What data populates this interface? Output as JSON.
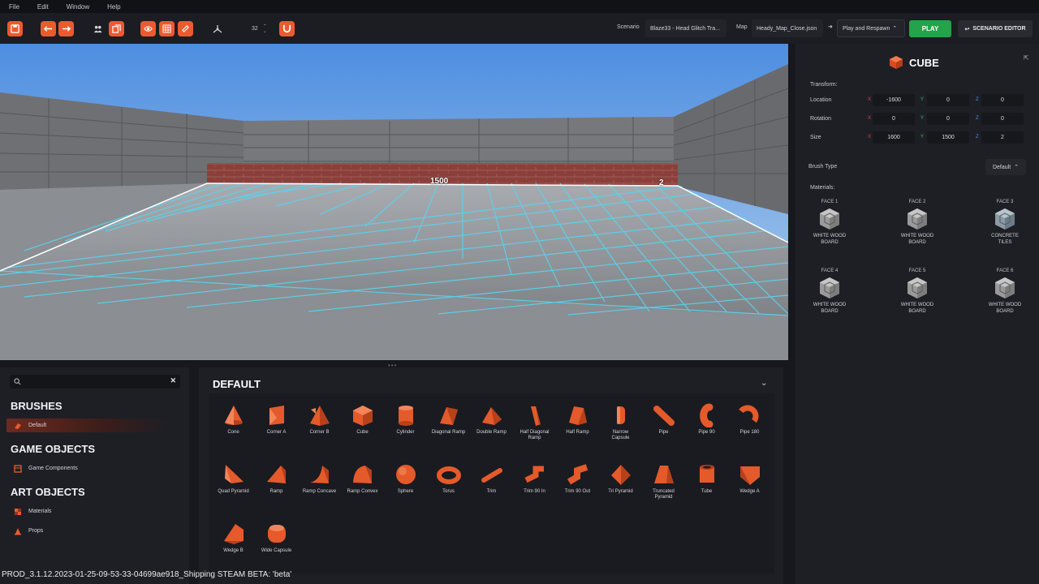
{
  "menu": [
    "File",
    "Edit",
    "Window",
    "Help"
  ],
  "toolbar": {
    "grid_size": "32",
    "scenario_label": "Scenario",
    "scenario_value": "Blaze33 - Head Glitch Tra...",
    "map_label": "Map",
    "map_value": "Heady_Map_Close.json",
    "respawn_label": "Play and Respawn",
    "play_label": "PLAY",
    "scenario_editor_label": "SCENARIO EDITOR",
    "accent": "#ec5a2f",
    "play_color": "#24a34a"
  },
  "viewport": {
    "dim_label_1": "1500",
    "dim_label_2": "2"
  },
  "inspector": {
    "title": "CUBE",
    "transform_label": "Transform:",
    "location_label": "Location",
    "rotation_label": "Rotation",
    "size_label": "Size",
    "axis_x": "X",
    "axis_y": "Y",
    "axis_z": "Z",
    "location": [
      "-1600",
      "0",
      "0"
    ],
    "rotation": [
      "0",
      "0",
      "0"
    ],
    "size": [
      "1600",
      "1500",
      "2"
    ],
    "brush_type_label": "Brush Type",
    "brush_type_value": "Default",
    "materials_label": "Materials:",
    "faces": [
      {
        "label": "FACE 1",
        "name_line1": "WHITE WOOD",
        "name_line2": "BOARD"
      },
      {
        "label": "FACE 2",
        "name_line1": "WHITE WOOD",
        "name_line2": "BOARD"
      },
      {
        "label": "FACE 3",
        "name_line1": "CONCRETE",
        "name_line2": "TILES"
      },
      {
        "label": "FACE 4",
        "name_line1": "WHITE WOOD",
        "name_line2": "BOARD"
      },
      {
        "label": "FACE 5",
        "name_line1": "WHITE WOOD",
        "name_line2": "BOARD"
      },
      {
        "label": "FACE 6",
        "name_line1": "WHITE WOOD",
        "name_line2": "BOARD"
      }
    ]
  },
  "library": {
    "search_placeholder": "",
    "brushes_heading": "BRUSHES",
    "brushes_default": "Default",
    "game_objects_heading": "GAME OBJECTS",
    "game_components": "Game Components",
    "art_objects_heading": "ART OBJECTS",
    "materials": "Materials",
    "props": "Props"
  },
  "assets": {
    "heading": "DEFAULT",
    "items": [
      {
        "l1": "Cone",
        "l2": "",
        "icon": "cone-icon"
      },
      {
        "l1": "Corner A",
        "l2": "",
        "icon": "corner-a-icon"
      },
      {
        "l1": "Corner B",
        "l2": "",
        "icon": "corner-b-icon"
      },
      {
        "l1": "Cube",
        "l2": "",
        "icon": "cube-icon"
      },
      {
        "l1": "Cylinder",
        "l2": "",
        "icon": "cylinder-icon"
      },
      {
        "l1": "Diagonal Ramp",
        "l2": "",
        "icon": "diagonal-ramp-icon"
      },
      {
        "l1": "Double Ramp",
        "l2": "",
        "icon": "double-ramp-icon"
      },
      {
        "l1": "Half Diagonal",
        "l2": "Ramp",
        "icon": "half-diagonal-ramp-icon"
      },
      {
        "l1": "Half Ramp",
        "l2": "",
        "icon": "half-ramp-icon"
      },
      {
        "l1": "Narrow",
        "l2": "Capsule",
        "icon": "narrow-capsule-icon"
      },
      {
        "l1": "Pipe",
        "l2": "",
        "icon": "pipe-icon"
      },
      {
        "l1": "Pipe 90",
        "l2": "",
        "icon": "pipe-90-icon"
      },
      {
        "l1": "Pipe 180",
        "l2": "",
        "icon": "pipe-180-icon"
      },
      {
        "l1": "Quad Pyramid",
        "l2": "",
        "icon": "quad-pyramid-icon"
      },
      {
        "l1": "Ramp",
        "l2": "",
        "icon": "ramp-icon"
      },
      {
        "l1": "Ramp Concave",
        "l2": "",
        "icon": "ramp-concave-icon"
      },
      {
        "l1": "Ramp Convex",
        "l2": "",
        "icon": "ramp-convex-icon"
      },
      {
        "l1": "Sphere",
        "l2": "",
        "icon": "sphere-icon"
      },
      {
        "l1": "Torus",
        "l2": "",
        "icon": "torus-icon"
      },
      {
        "l1": "Trim",
        "l2": "",
        "icon": "trim-icon"
      },
      {
        "l1": "Trim 90 In",
        "l2": "",
        "icon": "trim-90-in-icon"
      },
      {
        "l1": "Trim 90 Out",
        "l2": "",
        "icon": "trim-90-out-icon"
      },
      {
        "l1": "Tri Pyramid",
        "l2": "",
        "icon": "tri-pyramid-icon"
      },
      {
        "l1": "Truncated",
        "l2": "Pyramid",
        "icon": "truncated-pyramid-icon"
      },
      {
        "l1": "Tube",
        "l2": "",
        "icon": "tube-icon"
      },
      {
        "l1": "Wedge A",
        "l2": "",
        "icon": "wedge-a-icon"
      },
      {
        "l1": "Wedge B",
        "l2": "",
        "icon": "wedge-b-icon"
      },
      {
        "l1": "Wide Capsule",
        "l2": "",
        "icon": "wide-capsule-icon"
      }
    ]
  },
  "status": "PROD_3.1.12.2023-01-25-09-53-33-04699ae918_Shipping STEAM BETA: 'beta'"
}
